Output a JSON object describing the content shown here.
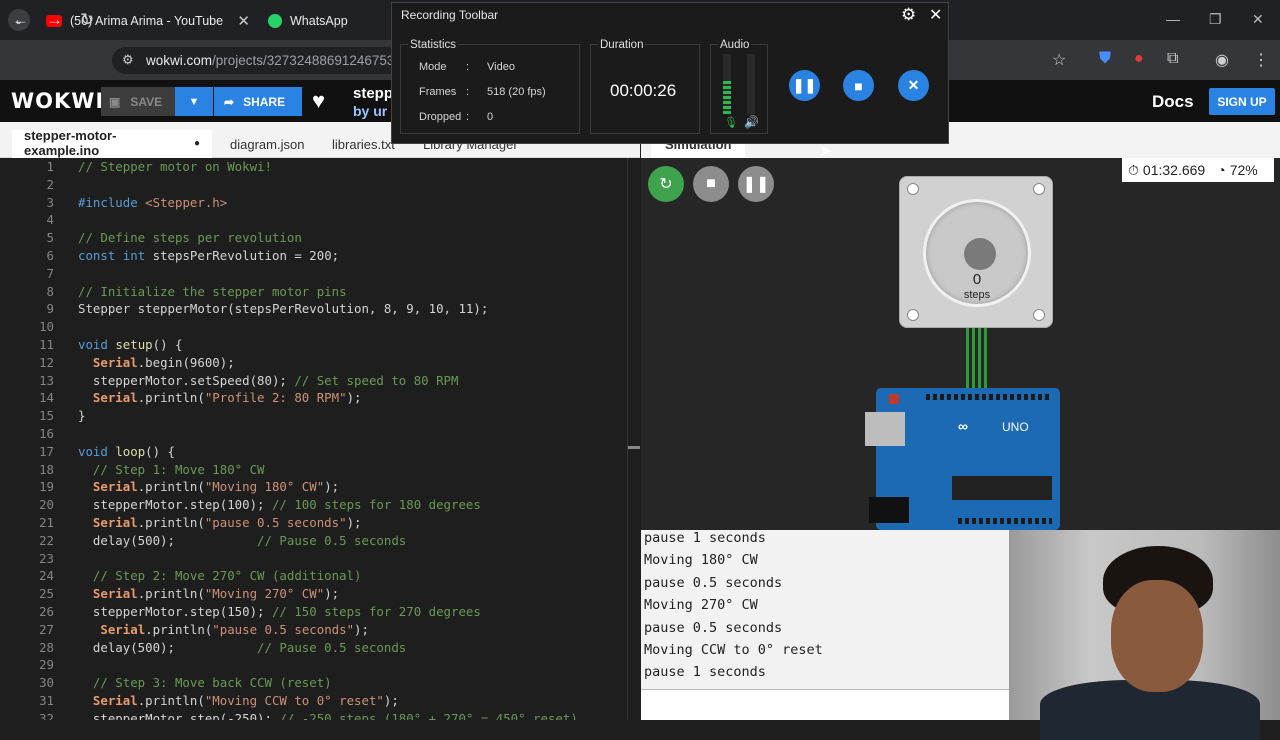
{
  "browser": {
    "tabs": [
      {
        "title": "(50) Arima Arima - YouTube"
      },
      {
        "title": "WhatsApp"
      }
    ],
    "url_host": "wokwi.com",
    "url_path": "/projects/327324886912467538"
  },
  "wokwi": {
    "logo": "WOKWI",
    "save_label": "SAVE",
    "share_label": "SHARE",
    "project_title": "stepp",
    "project_by": "by ur",
    "docs_label": "Docs",
    "signup_label": "SIGN UP"
  },
  "editor_tabs": [
    {
      "label": "stepper-motor-example.ino",
      "active": true,
      "modified": true
    },
    {
      "label": "diagram.json"
    },
    {
      "label": "libraries.txt"
    },
    {
      "label": "Library Manager"
    }
  ],
  "code_lines": [
    {
      "n": "1",
      "t": "// Stepper motor on Wokwi!",
      "k": "com"
    },
    {
      "n": "2",
      "t": "",
      "k": ""
    },
    {
      "n": "3",
      "t": "#include <Stepper.h>",
      "k": "inc"
    },
    {
      "n": "4",
      "t": "",
      "k": ""
    },
    {
      "n": "5",
      "t": "// Define steps per revolution",
      "k": "com"
    },
    {
      "n": "6",
      "t": "const int stepsPerRevolution = 200;",
      "k": "decl"
    },
    {
      "n": "7",
      "t": "",
      "k": ""
    },
    {
      "n": "8",
      "t": "// Initialize the stepper motor pins",
      "k": "com"
    },
    {
      "n": "9",
      "t": "Stepper stepperMotor(stepsPerRevolution, 8, 9, 10, 11);",
      "k": "plain"
    },
    {
      "n": "10",
      "t": "",
      "k": ""
    },
    {
      "n": "11",
      "t": "void setup() {",
      "k": "fn"
    },
    {
      "n": "12",
      "t": "  Serial.begin(9600);",
      "k": "ser"
    },
    {
      "n": "13",
      "t": "  stepperMotor.setSpeed(80); // Set speed to 80 RPM",
      "k": "mixed"
    },
    {
      "n": "14",
      "t": "  Serial.println(\"Profile 2: 80 RPM\");",
      "k": "ser"
    },
    {
      "n": "15",
      "t": "}",
      "k": "plain"
    },
    {
      "n": "16",
      "t": "",
      "k": ""
    },
    {
      "n": "17",
      "t": "void loop() {",
      "k": "fn"
    },
    {
      "n": "18",
      "t": "  // Step 1: Move 180° CW",
      "k": "com"
    },
    {
      "n": "19",
      "t": "  Serial.println(\"Moving 180° CW\");",
      "k": "ser"
    },
    {
      "n": "20",
      "t": "  stepperMotor.step(100); // 100 steps for 180 degrees",
      "k": "mixed"
    },
    {
      "n": "21",
      "t": "  Serial.println(\"pause 0.5 seconds\");",
      "k": "ser"
    },
    {
      "n": "22",
      "t": "  delay(500);           // Pause 0.5 seconds",
      "k": "mixed"
    },
    {
      "n": "23",
      "t": "",
      "k": ""
    },
    {
      "n": "24",
      "t": "  // Step 2: Move 270° CW (additional)",
      "k": "com"
    },
    {
      "n": "25",
      "t": "  Serial.println(\"Moving 270° CW\");",
      "k": "ser"
    },
    {
      "n": "26",
      "t": "  stepperMotor.step(150); // 150 steps for 270 degrees",
      "k": "mixed"
    },
    {
      "n": "27",
      "t": "   Serial.println(\"pause 0.5 seconds\");",
      "k": "ser"
    },
    {
      "n": "28",
      "t": "  delay(500);           // Pause 0.5 seconds",
      "k": "mixed"
    },
    {
      "n": "29",
      "t": "",
      "k": ""
    },
    {
      "n": "30",
      "t": "  // Step 3: Move back CCW (reset)",
      "k": "com"
    },
    {
      "n": "31",
      "t": "  Serial.println(\"Moving CCW to 0° reset\");",
      "k": "ser"
    },
    {
      "n": "32",
      "t": "  stepperMotor.step(-250); // -250 steps (180° + 270° = 450° reset)",
      "k": "mixed"
    }
  ],
  "simulation": {
    "tab_label": "Simulation",
    "timer": "01:32.669",
    "speed": "72%",
    "motor_steps": "0",
    "motor_steps_label": "steps",
    "board_label": "UNO"
  },
  "serial_lines": [
    "pause 1 seconds",
    "Moving 180° CW",
    "pause 0.5 seconds",
    "Moving 270° CW",
    "pause 0.5 seconds",
    "Moving CCW to 0° reset",
    "pause 1 seconds"
  ],
  "recording_toolbar": {
    "title": "Recording Toolbar",
    "statistics_label": "Statistics",
    "mode_label": "Mode",
    "mode_value": "Video",
    "frames_label": "Frames",
    "frames_value": "518 (20 fps)",
    "dropped_label": "Dropped",
    "dropped_value": "0",
    "duration_label": "Duration",
    "duration_value": "00:00:26",
    "audio_label": "Audio",
    "sep": ":"
  },
  "colors": {
    "accent": "#2a83e2",
    "sim_green": "#3fa34d",
    "board": "#1c6ab3"
  }
}
